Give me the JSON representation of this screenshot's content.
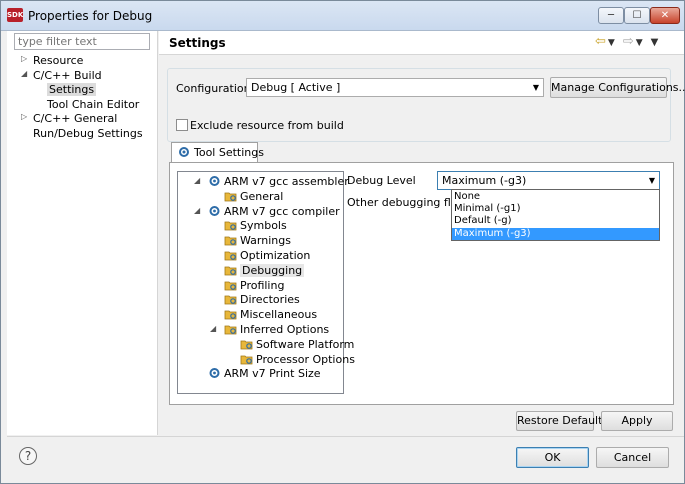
{
  "window": {
    "title": "Properties for Debug",
    "app_icon_text": "SDK"
  },
  "title_buttons": {
    "minimize": "─",
    "maximize": "☐",
    "close": "✕"
  },
  "filter": {
    "placeholder": "type filter text"
  },
  "nav": [
    {
      "label": "Resource",
      "twisty": "▷",
      "selected": false
    },
    {
      "label": "C/C++ Build",
      "twisty": "◢",
      "selected": false
    },
    {
      "label": "Settings",
      "twisty": "",
      "selected": true
    },
    {
      "label": "Tool Chain Editor",
      "twisty": "",
      "selected": false
    },
    {
      "label": "C/C++ General",
      "twisty": "▷",
      "selected": false
    },
    {
      "label": "Run/Debug Settings",
      "twisty": "",
      "selected": false
    }
  ],
  "header": {
    "title": "Settings",
    "nav_icons": [
      "back-icon",
      "forward-icon",
      "view-menu-icon"
    ]
  },
  "config": {
    "label": "Configuration:",
    "value": "Debug  [ Active ]",
    "manage_button": "Manage Configurations...",
    "exclude_label": "Exclude resource from build",
    "exclude_checked": false
  },
  "tab": {
    "label": "Tool Settings"
  },
  "tool_tree": [
    {
      "label": "ARM v7 gcc assembler",
      "level": 0,
      "twisty": "◢",
      "icon": "tool-icon"
    },
    {
      "label": "General",
      "level": 1,
      "twisty": "",
      "icon": "folder-icon"
    },
    {
      "label": "ARM v7 gcc compiler",
      "level": 0,
      "twisty": "◢",
      "icon": "tool-icon"
    },
    {
      "label": "Symbols",
      "level": 1,
      "twisty": "",
      "icon": "folder-icon"
    },
    {
      "label": "Warnings",
      "level": 1,
      "twisty": "",
      "icon": "folder-icon"
    },
    {
      "label": "Optimization",
      "level": 1,
      "twisty": "",
      "icon": "folder-icon"
    },
    {
      "label": "Debugging",
      "level": 1,
      "twisty": "",
      "icon": "folder-icon",
      "selected": true
    },
    {
      "label": "Profiling",
      "level": 1,
      "twisty": "",
      "icon": "folder-icon"
    },
    {
      "label": "Directories",
      "level": 1,
      "twisty": "",
      "icon": "folder-icon"
    },
    {
      "label": "Miscellaneous",
      "level": 1,
      "twisty": "",
      "icon": "folder-icon"
    },
    {
      "label": "Inferred Options",
      "level": 1,
      "twisty": "◢",
      "icon": "folder-icon"
    },
    {
      "label": "Software Platform",
      "level": 2,
      "twisty": "",
      "icon": "folder-icon"
    },
    {
      "label": "Processor Options",
      "level": 2,
      "twisty": "",
      "icon": "folder-icon"
    },
    {
      "label": "ARM v7 Print Size",
      "level": 0,
      "twisty": "",
      "icon": "tool-icon"
    }
  ],
  "debug": {
    "level_label": "Debug Level",
    "level_value": "Maximum (-g3)",
    "other_flags_label": "Other debugging flags",
    "options": [
      "None",
      "Minimal (-g1)",
      "Default (-g)",
      "Maximum (-g3)"
    ],
    "highlighted": "Maximum (-g3)"
  },
  "buttons": {
    "restore_defaults": "Restore Defaults",
    "apply": "Apply",
    "ok": "OK",
    "cancel": "Cancel",
    "help": "?"
  },
  "colors": {
    "selection": "#3399ff",
    "folder": "#e8b73a",
    "tool_icon": "#2d6ca8"
  }
}
